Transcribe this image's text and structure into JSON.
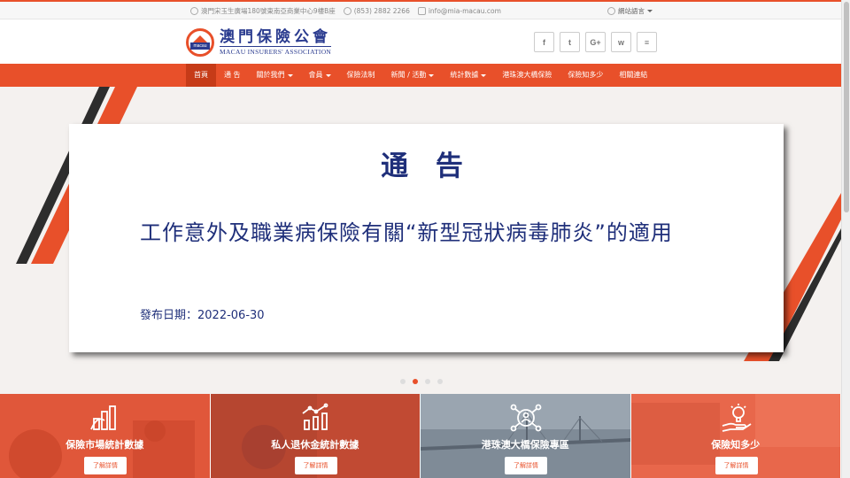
{
  "topbar": {
    "address": "澳門宋玉生廣場180號東南亞商業中心9樓B座",
    "phone": "(853) 2882 2266",
    "email": "info@mia-macau.com",
    "language": "網站語言"
  },
  "logo": {
    "mark_text": "macau",
    "name_zh": "澳門保險公會",
    "name_en": "MACAU INSURERS' ASSOCIATION"
  },
  "social": [
    "f",
    "t",
    "G+",
    "w",
    "≡"
  ],
  "nav": {
    "items": [
      {
        "label": "首頁"
      },
      {
        "label": "通 告"
      },
      {
        "label": "關於我們"
      },
      {
        "label": "會員"
      },
      {
        "label": "保險法制"
      },
      {
        "label": "新聞 / 活動"
      },
      {
        "label": "統計數據"
      },
      {
        "label": "港珠澳大橋保險"
      },
      {
        "label": "保險知多少"
      },
      {
        "label": "相關連結"
      }
    ]
  },
  "hero": {
    "title": "通 告",
    "headline": "工作意外及職業病保險有關“新型冠狀病毒肺炎”的適用",
    "date": "發布日期：2022-06-30"
  },
  "tiles": [
    {
      "label": "保險市場統計數據",
      "button": "了解詳情"
    },
    {
      "label": "私人退休金統計數據",
      "button": "了解詳情"
    },
    {
      "label": "港珠澳大橋保險專區",
      "button": "了解詳情"
    },
    {
      "label": "保險知多少",
      "button": "了解詳情"
    }
  ],
  "colors": {
    "accent": "#e8502a",
    "navy": "#1f2f7a"
  }
}
